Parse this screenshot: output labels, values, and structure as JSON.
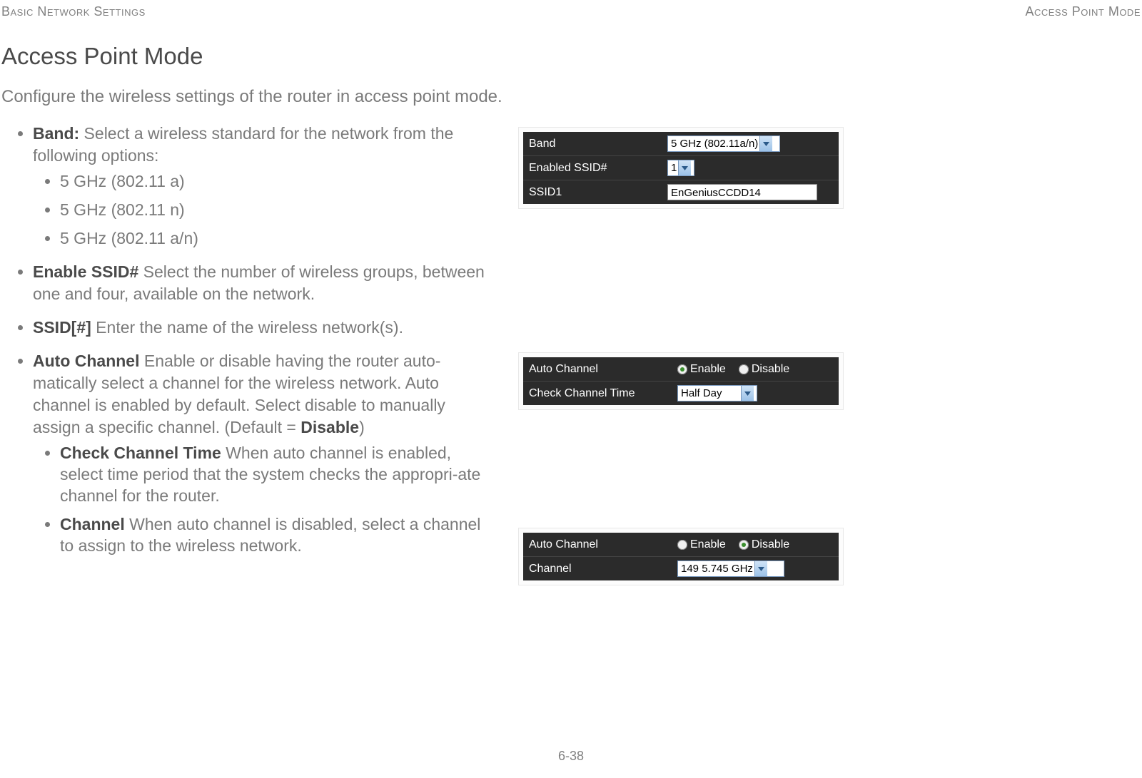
{
  "header": {
    "left": "Basic Network Settings",
    "right": "Access Point Mode"
  },
  "title": "Access Point Mode",
  "intro": "Configure the wireless settings of the router in access point mode.",
  "bullets": {
    "band_term": "Band:",
    "band_desc": " Select a wireless standard for the network from the following options:",
    "band_opts": [
      "5 GHz (802.11 a)",
      "5 GHz (802.11 n)",
      "5 GHz (802.11 a/n)"
    ],
    "enable_ssid_term": "Enable SSID#",
    "enable_ssid_desc": "  Select the number of wireless groups, between one and four, available on the network.",
    "ssid_term": "SSID[#]",
    "ssid_desc": "  Enter the name of the wireless network(s).",
    "auto_term": "Auto Channel",
    "auto_desc_a": "  Enable or disable having the router auto-matically select a channel for the wireless network. Auto channel is enabled by default. Select disable to manually assign a specific channel. (Default = ",
    "auto_desc_default": "Disable",
    "auto_desc_b": ")",
    "check_term": "Check Channel Time",
    "check_desc": "  When auto channel is enabled, select time period that the system checks the appropri-ate channel for the router.",
    "channel_term": "Channel",
    "channel_desc": " When auto channel is disabled, select a channel to assign to the wireless network."
  },
  "panel1": {
    "band_label": "Band",
    "band_value": "5 GHz (802.11a/n)",
    "enabled_label": "Enabled SSID#",
    "enabled_value": "1",
    "ssid1_label": "SSID1",
    "ssid1_value": "EnGeniusCCDD14"
  },
  "panel2": {
    "auto_label": "Auto Channel",
    "enable_text": "Enable",
    "disable_text": "Disable",
    "selected": "enable",
    "check_label": "Check Channel Time",
    "check_value": "Half Day"
  },
  "panel3": {
    "auto_label": "Auto Channel",
    "enable_text": "Enable",
    "disable_text": "Disable",
    "selected": "disable",
    "channel_label": "Channel",
    "channel_value": "149  5.745 GHz"
  },
  "page_number": "6-38"
}
